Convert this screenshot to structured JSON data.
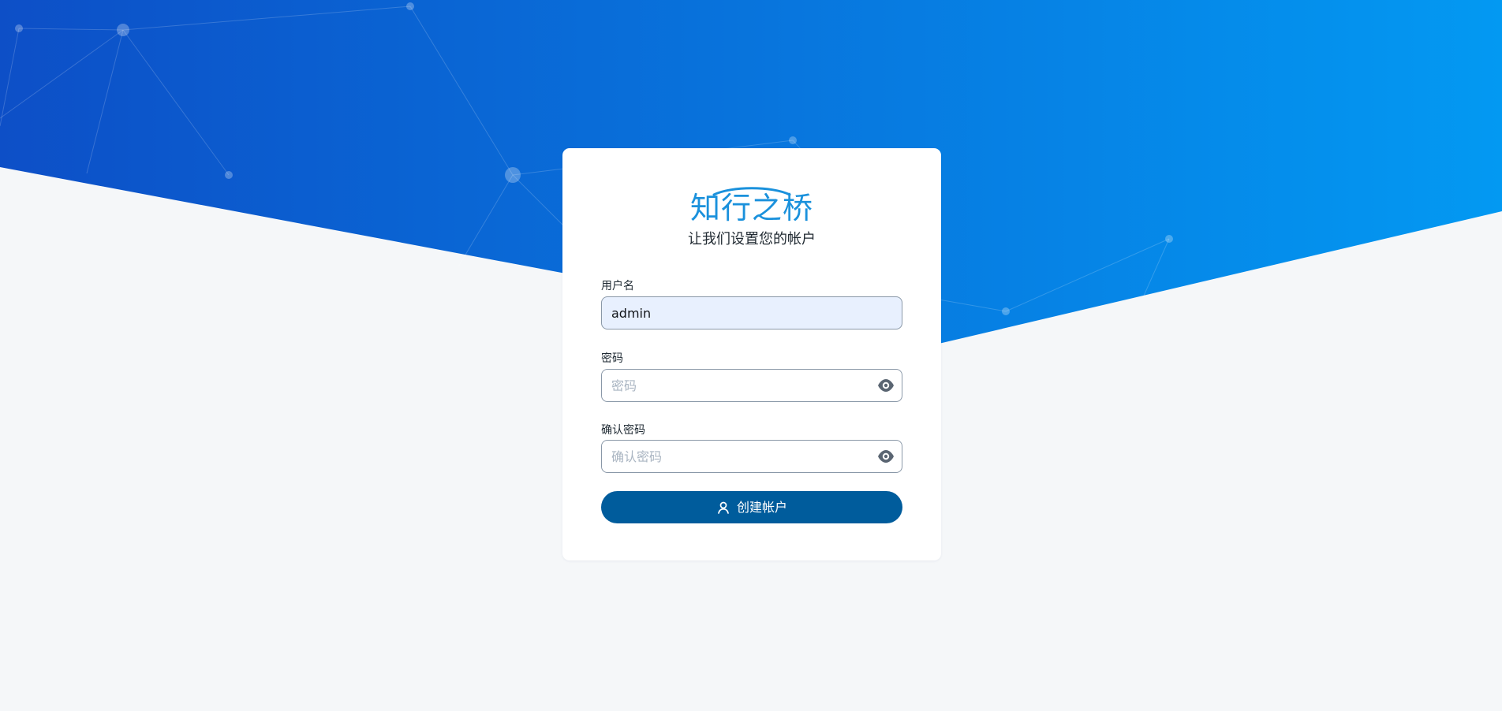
{
  "brand": {
    "name": "知行之桥",
    "colors": {
      "header_start": "#0d4fc7",
      "header_end": "#0399f2",
      "page_background": "#f5f7f9",
      "brand_blue": "#1a91dc",
      "primary_button": "#005c9c"
    }
  },
  "card": {
    "subtitle": "让我们设置您的帐户"
  },
  "form": {
    "username": {
      "label": "用户名",
      "value": "admin"
    },
    "password": {
      "label": "密码",
      "placeholder": "密码",
      "toggle_icon": "eye-icon"
    },
    "confirm_password": {
      "label": "确认密码",
      "placeholder": "确认密码",
      "toggle_icon": "eye-icon"
    },
    "submit": {
      "label": "创建帐户",
      "icon": "user-icon"
    }
  }
}
